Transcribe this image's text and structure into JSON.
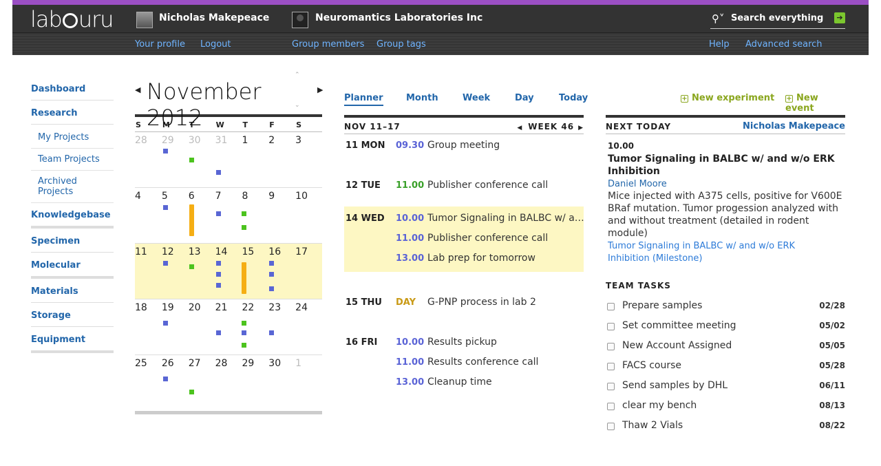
{
  "header": {
    "logo": "labguru",
    "user_name": "Nicholas Makepeace",
    "lab_name": "Neuromantics Laboratories Inc",
    "search_placeholder": "Search everything",
    "search_go": "➔",
    "links": {
      "your_profile": "Your profile",
      "logout": "Logout",
      "group_members": "Group members",
      "group_tags": "Group tags",
      "help": "Help",
      "advanced_search": "Advanced search"
    }
  },
  "sidebar": {
    "dashboard": "Dashboard",
    "research": "Research",
    "my_projects": "My Projects",
    "team_projects": "Team Projects",
    "archived_projects": "Archived Projects",
    "knowledgebase": "Knowledgebase",
    "specimen": "Specimen",
    "molecular": "Molecular",
    "materials": "Materials",
    "storage": "Storage",
    "equipment": "Equipment"
  },
  "calendar": {
    "prev": "◀",
    "next": "▶",
    "month": "November 2012",
    "up": "⌃",
    "down": "⌄",
    "dow": [
      "S",
      "M",
      "T",
      "W",
      "T",
      "F",
      "S"
    ],
    "weeks": [
      [
        "28",
        "29",
        "30",
        "31",
        "1",
        "2",
        "3"
      ],
      [
        "4",
        "5",
        "6",
        "7",
        "8",
        "9",
        "10"
      ],
      [
        "11",
        "12",
        "13",
        "14",
        "15",
        "16",
        "17"
      ],
      [
        "18",
        "19",
        "20",
        "21",
        "22",
        "23",
        "24"
      ],
      [
        "25",
        "26",
        "27",
        "28",
        "29",
        "30",
        "1"
      ]
    ],
    "colors": {
      "blue": "#5966d4",
      "green": "#4cc31e",
      "orange": "#f5ae14",
      "highlight": "#fdf7c3"
    }
  },
  "planner": {
    "tabs": {
      "planner": "Planner",
      "month": "Month",
      "week": "Week",
      "day": "Day",
      "today": "Today"
    },
    "range": "NOV 11–17",
    "week_prev": "◀",
    "week_label": "WEEK 46",
    "week_next": "▶",
    "days": [
      {
        "date": "11 MON",
        "events": [
          {
            "time": "09.30",
            "title": "Group meeting"
          }
        ]
      },
      {
        "date": "12 TUE",
        "events": [
          {
            "time": "11.00",
            "title": "Publisher conference call"
          }
        ]
      },
      {
        "date": "14 WED",
        "events": [
          {
            "time": "10.00",
            "title": "Tumor Signaling in BALBC w/ and w/o ERK Inhibition"
          },
          {
            "time": "11.00",
            "title": "Publisher conference call"
          },
          {
            "time": "13.00",
            "title": "Lab prep for tomorrow"
          }
        ]
      },
      {
        "date": "15 THU",
        "events": [
          {
            "time": "DAY",
            "title": "G-PNP process in lab 2"
          }
        ]
      },
      {
        "date": "16 FRI",
        "events": [
          {
            "time": "10.00",
            "title": "Results pickup"
          },
          {
            "time": "11.00",
            "title": "Results conference call"
          },
          {
            "time": "13.00",
            "title": "Cleanup time"
          }
        ]
      }
    ]
  },
  "right": {
    "new_experiment": "New experiment",
    "new_event": "New event",
    "plus": "+",
    "next_today": "NEXT TODAY",
    "owner": "Nicholas Makepeace",
    "event": {
      "time": "10.00",
      "title": "Tumor Signaling in BALBC w/ and w/o ERK Inhibition",
      "person": "Daniel Moore",
      "description": "Mice injected with A375 cells, positive for V600E BRaf mutation. Tumor progession analyzed with and without treatment (detailed in rodent module)",
      "link": "Tumor Signaling in BALBC w/ and w/o ERK Inhibition (Milestone)"
    },
    "team_tasks_title": "TEAM TASKS",
    "tasks": [
      {
        "label": "Prepare samples",
        "date": "02/28"
      },
      {
        "label": "Set committee meeting",
        "date": "05/02"
      },
      {
        "label": "New Account Assigned",
        "date": "05/05"
      },
      {
        "label": "FACS course",
        "date": "05/28"
      },
      {
        "label": "Send samples by DHL",
        "date": "06/11"
      },
      {
        "label": "clear my bench",
        "date": "08/13"
      },
      {
        "label": "Thaw 2 Vials",
        "date": "08/22"
      }
    ]
  }
}
